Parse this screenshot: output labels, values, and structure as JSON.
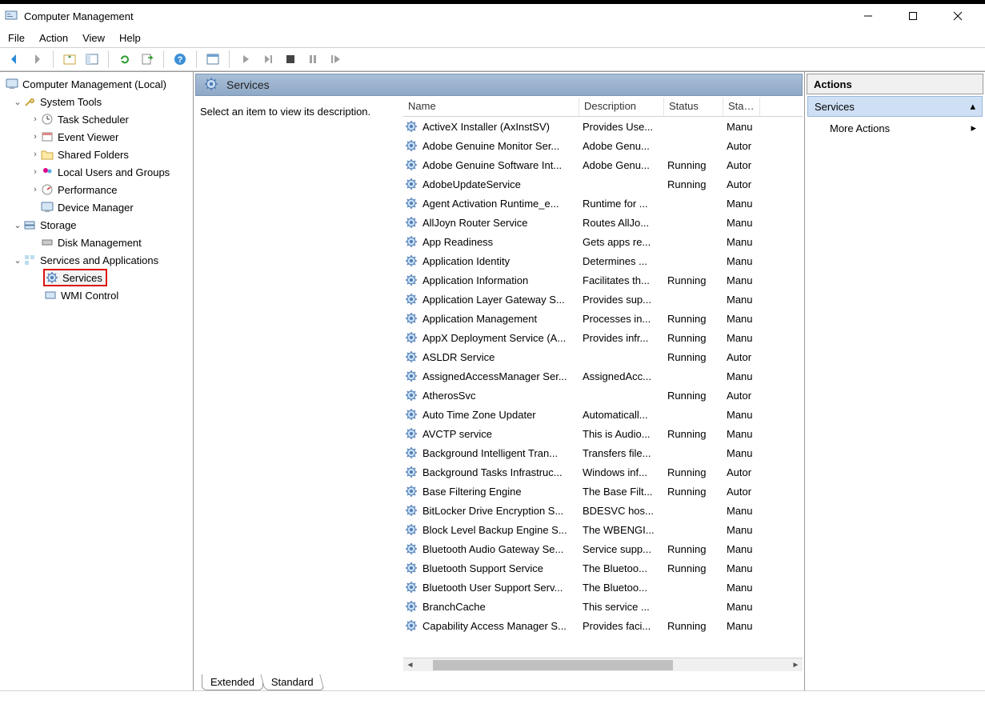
{
  "window": {
    "title": "Computer Management"
  },
  "menu": {
    "file": "File",
    "action": "Action",
    "view": "View",
    "help": "Help"
  },
  "tree": {
    "root": "Computer Management (Local)",
    "system_tools": "System Tools",
    "task_scheduler": "Task Scheduler",
    "event_viewer": "Event Viewer",
    "shared_folders": "Shared Folders",
    "local_users": "Local Users and Groups",
    "performance": "Performance",
    "device_manager": "Device Manager",
    "storage": "Storage",
    "disk_management": "Disk Management",
    "services_apps": "Services and Applications",
    "services": "Services",
    "wmi": "WMI Control"
  },
  "center": {
    "header": "Services",
    "hint": "Select an item to view its description.",
    "columns": {
      "name": "Name",
      "desc": "Description",
      "status": "Status",
      "start": "Startu"
    },
    "tabs": {
      "extended": "Extended",
      "standard": "Standard"
    }
  },
  "actions": {
    "header": "Actions",
    "section": "Services",
    "more": "More Actions"
  },
  "services": [
    {
      "name": "ActiveX Installer (AxInstSV)",
      "desc": "Provides Use...",
      "status": "",
      "start": "Manu"
    },
    {
      "name": "Adobe Genuine Monitor Ser...",
      "desc": "Adobe Genu...",
      "status": "",
      "start": "Autor"
    },
    {
      "name": "Adobe Genuine Software Int...",
      "desc": "Adobe Genu...",
      "status": "Running",
      "start": "Autor"
    },
    {
      "name": "AdobeUpdateService",
      "desc": "",
      "status": "Running",
      "start": "Autor"
    },
    {
      "name": "Agent Activation Runtime_e...",
      "desc": "Runtime for ...",
      "status": "",
      "start": "Manu"
    },
    {
      "name": "AllJoyn Router Service",
      "desc": "Routes AllJo...",
      "status": "",
      "start": "Manu"
    },
    {
      "name": "App Readiness",
      "desc": "Gets apps re...",
      "status": "",
      "start": "Manu"
    },
    {
      "name": "Application Identity",
      "desc": "Determines ...",
      "status": "",
      "start": "Manu"
    },
    {
      "name": "Application Information",
      "desc": "Facilitates th...",
      "status": "Running",
      "start": "Manu"
    },
    {
      "name": "Application Layer Gateway S...",
      "desc": "Provides sup...",
      "status": "",
      "start": "Manu"
    },
    {
      "name": "Application Management",
      "desc": "Processes in...",
      "status": "Running",
      "start": "Manu"
    },
    {
      "name": "AppX Deployment Service (A...",
      "desc": "Provides infr...",
      "status": "Running",
      "start": "Manu"
    },
    {
      "name": "ASLDR Service",
      "desc": "",
      "status": "Running",
      "start": "Autor"
    },
    {
      "name": "AssignedAccessManager Ser...",
      "desc": "AssignedAcc...",
      "status": "",
      "start": "Manu"
    },
    {
      "name": "AtherosSvc",
      "desc": "",
      "status": "Running",
      "start": "Autor"
    },
    {
      "name": "Auto Time Zone Updater",
      "desc": "Automaticall...",
      "status": "",
      "start": "Manu"
    },
    {
      "name": "AVCTP service",
      "desc": "This is Audio...",
      "status": "Running",
      "start": "Manu"
    },
    {
      "name": "Background Intelligent Tran...",
      "desc": "Transfers file...",
      "status": "",
      "start": "Manu"
    },
    {
      "name": "Background Tasks Infrastruc...",
      "desc": "Windows inf...",
      "status": "Running",
      "start": "Autor"
    },
    {
      "name": "Base Filtering Engine",
      "desc": "The Base Filt...",
      "status": "Running",
      "start": "Autor"
    },
    {
      "name": "BitLocker Drive Encryption S...",
      "desc": "BDESVC hos...",
      "status": "",
      "start": "Manu"
    },
    {
      "name": "Block Level Backup Engine S...",
      "desc": "The WBENGI...",
      "status": "",
      "start": "Manu"
    },
    {
      "name": "Bluetooth Audio Gateway Se...",
      "desc": "Service supp...",
      "status": "Running",
      "start": "Manu"
    },
    {
      "name": "Bluetooth Support Service",
      "desc": "The Bluetoo...",
      "status": "Running",
      "start": "Manu"
    },
    {
      "name": "Bluetooth User Support Serv...",
      "desc": "The Bluetoo...",
      "status": "",
      "start": "Manu"
    },
    {
      "name": "BranchCache",
      "desc": "This service ...",
      "status": "",
      "start": "Manu"
    },
    {
      "name": "Capability Access Manager S...",
      "desc": "Provides faci...",
      "status": "Running",
      "start": "Manu"
    }
  ]
}
